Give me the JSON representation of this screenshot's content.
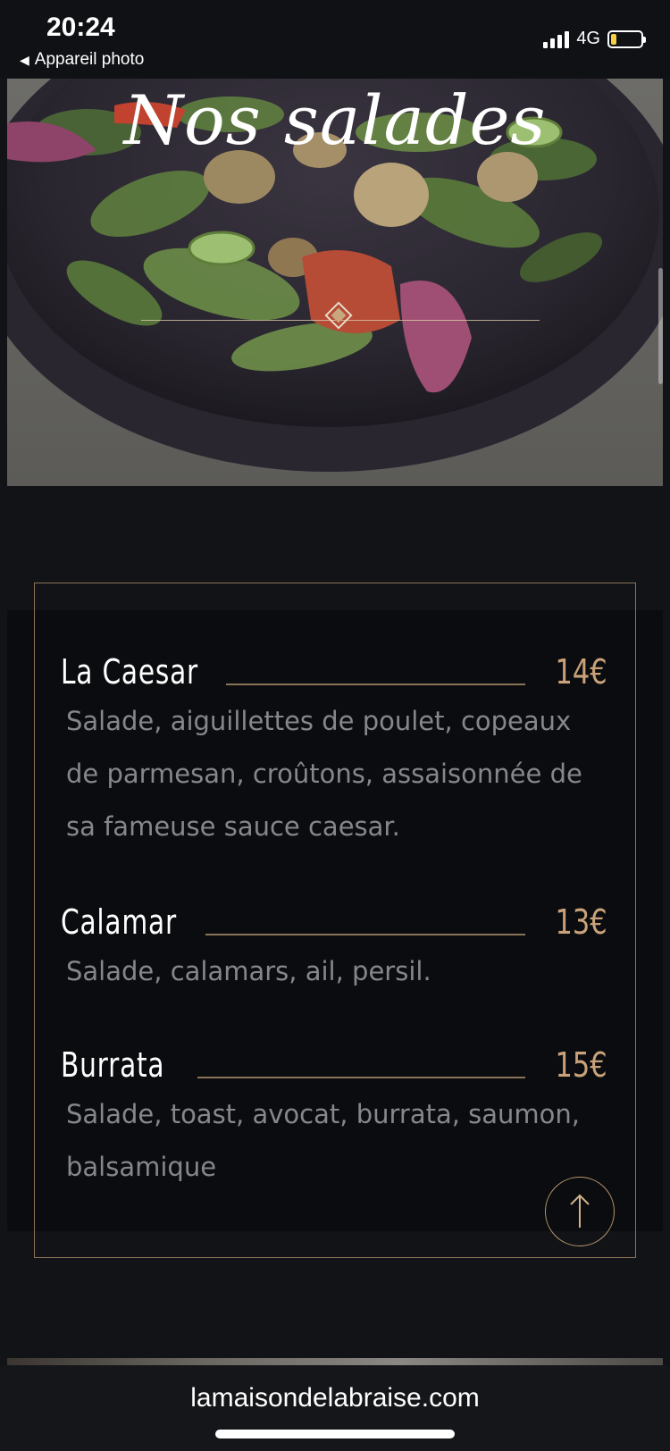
{
  "status_bar": {
    "time": "20:24",
    "back_label": "Appareil photo",
    "network": "4G",
    "battery_level": 0.2,
    "signal_bars": 4
  },
  "hero": {
    "title": "Nos salades",
    "image": "salad-plate-photo"
  },
  "menu": {
    "items": [
      {
        "name": "La Caesar",
        "price": "14€",
        "description": "Salade, aiguillettes de poulet, copeaux de parmesan, croûtons, assaisonnée de sa fameuse sauce caesar."
      },
      {
        "name": "Calamar",
        "price": "13€",
        "description": "Salade, calamars, ail, persil."
      },
      {
        "name": "Burrata",
        "price": "15€",
        "description": "Salade, toast, avocat, burrata, saumon, balsamique"
      }
    ],
    "scroll_top_icon": "arrow-up-icon"
  },
  "browser": {
    "url": "lamaisondelabraise.com"
  },
  "colors": {
    "background": "#111317",
    "accent": "#c9a27a",
    "frame": "#8a7358",
    "description_text": "#86878c"
  }
}
